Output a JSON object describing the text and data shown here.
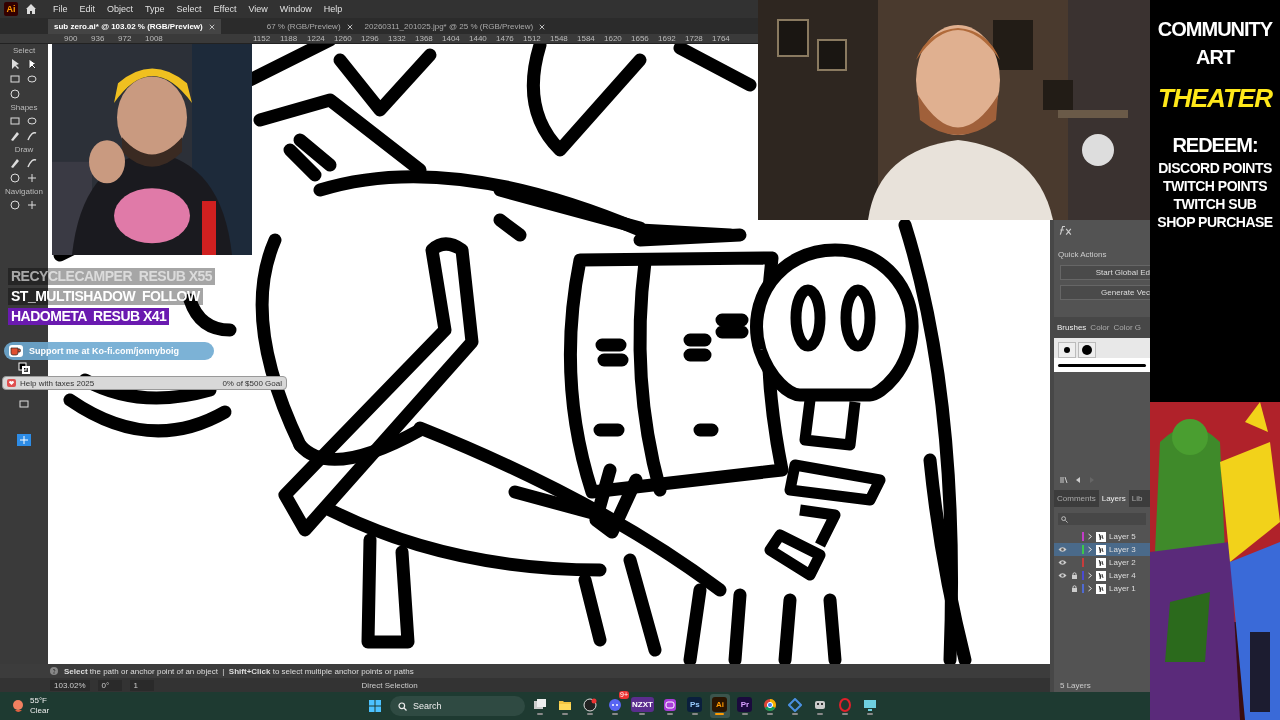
{
  "app": {
    "logo": "Ai",
    "menu": [
      "File",
      "Edit",
      "Object",
      "Type",
      "Select",
      "Effect",
      "View",
      "Window",
      "Help"
    ]
  },
  "document_tabs": [
    {
      "label": "sub zero.ai* @ 103.02 % (RGB/Preview)",
      "selected": true
    },
    {
      "label": "67 % (RGB/Preview)",
      "selected": false
    },
    {
      "label": "20260311_201025.jpg* @ 25 % (RGB/Preview)",
      "selected": false
    }
  ],
  "ruler": [
    "900",
    "936",
    "972",
    "1008",
    "1152",
    "1188",
    "1224",
    "1260",
    "1296",
    "1332",
    "1368",
    "1404",
    "1440",
    "1476",
    "1512",
    "1548",
    "1584",
    "1620",
    "1656",
    "1692",
    "1728",
    "1764"
  ],
  "toolbar": {
    "groups": [
      {
        "label": "Select"
      },
      {
        "label": "Shapes"
      },
      {
        "label": "Draw"
      },
      {
        "label": "Navigation"
      }
    ]
  },
  "properties_panel": {
    "quick_actions_title": "Quick Actions",
    "buttons": [
      "Start Global Ed",
      "Generate Vec"
    ],
    "tabs": [
      {
        "label": "Brushes",
        "selected": true
      },
      {
        "label": "Color",
        "selected": false
      },
      {
        "label": "Color G",
        "selected": false
      }
    ]
  },
  "layers_panel": {
    "tabs": [
      {
        "label": "Comments",
        "selected": false
      },
      {
        "label": "Layers",
        "selected": true
      },
      {
        "label": "Lib",
        "selected": false
      }
    ],
    "layers": [
      {
        "name": "Layer 5",
        "color": "#c23cc8",
        "visible": false,
        "locked": false,
        "expandable": true,
        "selected": false
      },
      {
        "name": "Layer 3",
        "color": "#3cc84a",
        "visible": true,
        "locked": false,
        "expandable": true,
        "selected": true
      },
      {
        "name": "Layer 2",
        "color": "#c83c3c",
        "visible": true,
        "locked": false,
        "expandable": false,
        "selected": false
      },
      {
        "name": "Layer 4",
        "color": "#4a4ad2",
        "visible": true,
        "locked": true,
        "expandable": true,
        "selected": false
      },
      {
        "name": "Layer 1",
        "color": "#4f6ad2",
        "visible": false,
        "locked": true,
        "expandable": true,
        "selected": false
      }
    ],
    "count": "5 Layers"
  },
  "status_bar": {
    "hint": "**Select** the path or anchor point of an object  |  **Shift+Click** to select multiple anchor points or paths",
    "zoom": "103.02%",
    "rotation": "0°",
    "artboard": "1",
    "tool": "Direct Selection"
  },
  "taskbar": {
    "weather": {
      "temperature": "55°F",
      "condition": "Clear"
    },
    "search": "Search",
    "apps": [
      {
        "kind": "windows",
        "active": false
      },
      {
        "kind": "desktop",
        "active": false
      },
      {
        "kind": "folder",
        "active": false
      },
      {
        "kind": "record",
        "active": false
      },
      {
        "kind": "chat",
        "badge": "9+",
        "active": false
      },
      {
        "kind": "tile",
        "label": "NZXT",
        "color": "#5b2d8e",
        "active": false
      },
      {
        "kind": "camera",
        "active": false
      },
      {
        "kind": "tile",
        "label": "Ps",
        "color": "#0a1f3d",
        "active": false
      },
      {
        "kind": "tile",
        "label": "Ai",
        "color": "#2a1400",
        "active": true
      },
      {
        "kind": "tile",
        "label": "Pr",
        "color": "#1a0a3d",
        "active": false
      },
      {
        "kind": "browser",
        "active": false
      },
      {
        "kind": "diamond",
        "active": false
      },
      {
        "kind": "robot",
        "active": false
      },
      {
        "kind": "ring",
        "active": false
      },
      {
        "kind": "monitor",
        "active": false
      }
    ]
  },
  "stream_overlay": {
    "events": [
      {
        "user": "RECYCLECAMPER",
        "event": "RESUB X55",
        "highlighted": false,
        "faded": true
      },
      {
        "user": "ST_MULTISHADOW",
        "event": "FOLLOW",
        "highlighted": false,
        "faded": false
      },
      {
        "user": "HADOMETA",
        "event": "RESUB X41",
        "highlighted": true,
        "faded": false
      }
    ],
    "kofi": "Support me at Ko-fi.com/jonnyboig",
    "goal": {
      "title": "Help with taxes 2025",
      "progress": "0% of $500 Goal",
      "level": 0
    }
  },
  "sidebar": {
    "lines": [
      {
        "text": "COMMUNITY",
        "kind": "title"
      },
      {
        "text": "ART",
        "kind": "title"
      },
      {
        "text": "THEATER",
        "kind": "accent"
      },
      {
        "text": "REDEEM:",
        "kind": "title"
      },
      {
        "text": "DISCORD POINTS",
        "kind": "item"
      },
      {
        "text": "TWITCH POINTS",
        "kind": "item"
      },
      {
        "text": "TWITCH SUB",
        "kind": "item"
      },
      {
        "text": "SHOP PURCHASE",
        "kind": "item"
      }
    ]
  }
}
